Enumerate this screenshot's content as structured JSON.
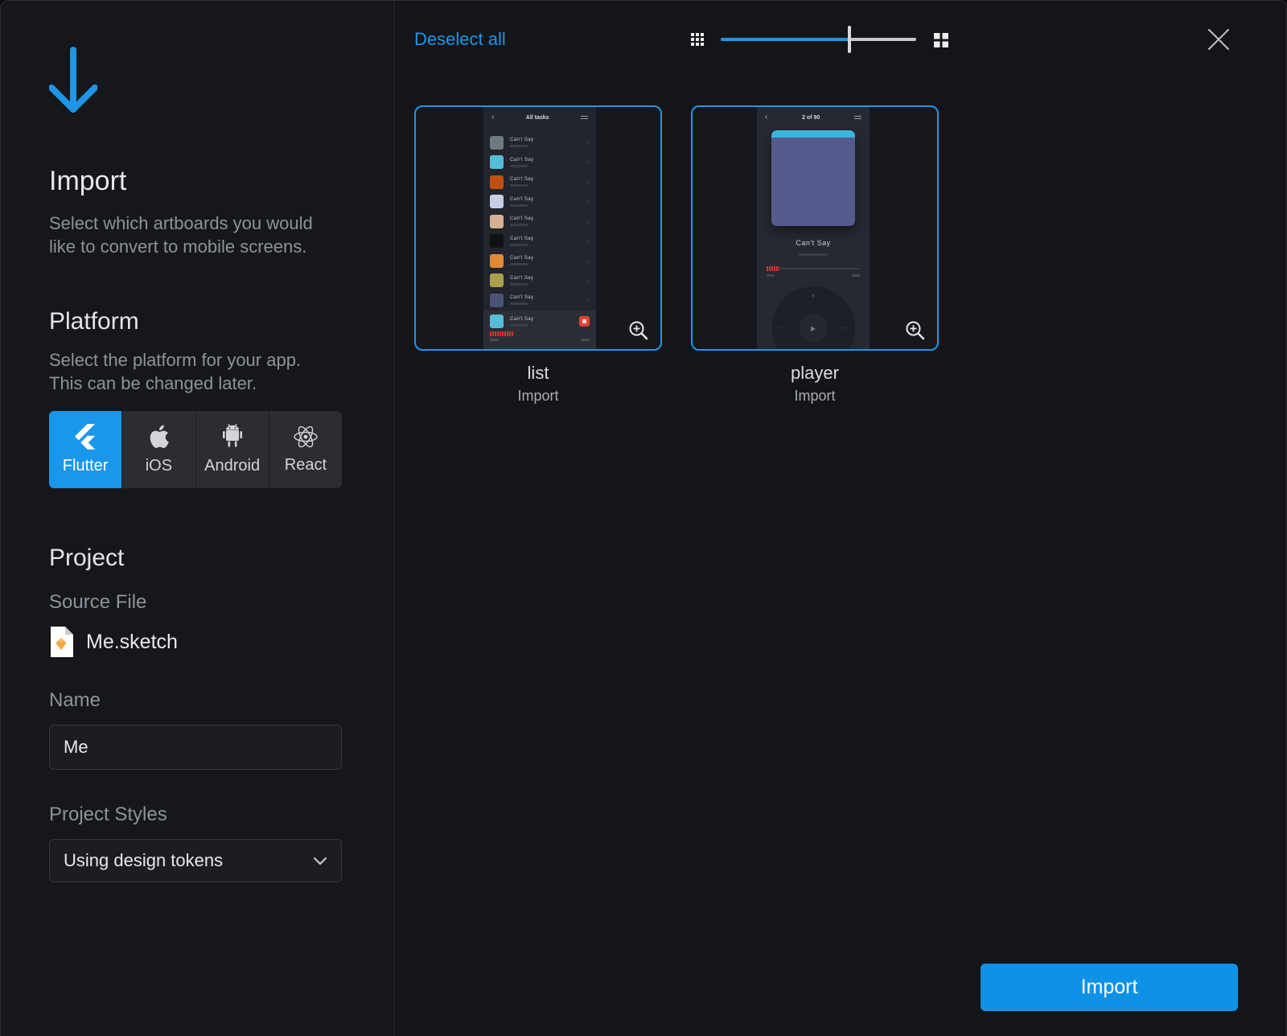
{
  "colors": {
    "accent": "#1e96e8",
    "platform_selected": "#1a97eb",
    "import_button": "#0f92e6",
    "selected_card_border": "#1e96e8",
    "sketch_icon_orange": "#f5a838"
  },
  "sidebar": {
    "title": "Import",
    "description": "Select which artboards you would like to convert to mobile screens.",
    "platform": {
      "title": "Platform",
      "description": "Select the platform for your app. This can be changed later.",
      "options": [
        {
          "label": "Flutter",
          "selected": true
        },
        {
          "label": "iOS",
          "selected": false
        },
        {
          "label": "Android",
          "selected": false
        },
        {
          "label": "React",
          "selected": false
        }
      ]
    },
    "project": {
      "title": "Project",
      "source_file_label": "Source File",
      "source_file_name": "Me.sketch",
      "name_label": "Name",
      "name_value": "Me",
      "styles_label": "Project Styles",
      "styles_value": "Using design tokens"
    }
  },
  "toolbar": {
    "deselect_all_label": "Deselect all",
    "slider_percent": 66
  },
  "artboards": [
    {
      "name": "list",
      "action": "Import",
      "selected": true,
      "preview": {
        "back": "‹",
        "header_title": "All tasks",
        "row_title": "Can't  Say",
        "row_chevron": "›",
        "row_colors": [
          "#6e7a80",
          "#56bcd8",
          "#c05012",
          "#c9cde6",
          "#d8b096",
          "#101114",
          "#e08a38",
          "#aaa04e",
          "#4c5276"
        ],
        "bottom_thumb_color": "#56bcd8",
        "bottom_title": "Can't  Say"
      }
    },
    {
      "name": "player",
      "action": "Import",
      "selected": true,
      "preview": {
        "back": "‹",
        "header_title": "2 of 90",
        "track_title": "Can't  Say",
        "play_glyph": "▶",
        "plus_glyph": "+",
        "minus_glyph": "—",
        "prev_glyph": "‹‹‹",
        "next_glyph": "›››"
      }
    }
  ],
  "footer": {
    "import_label": "Import"
  }
}
